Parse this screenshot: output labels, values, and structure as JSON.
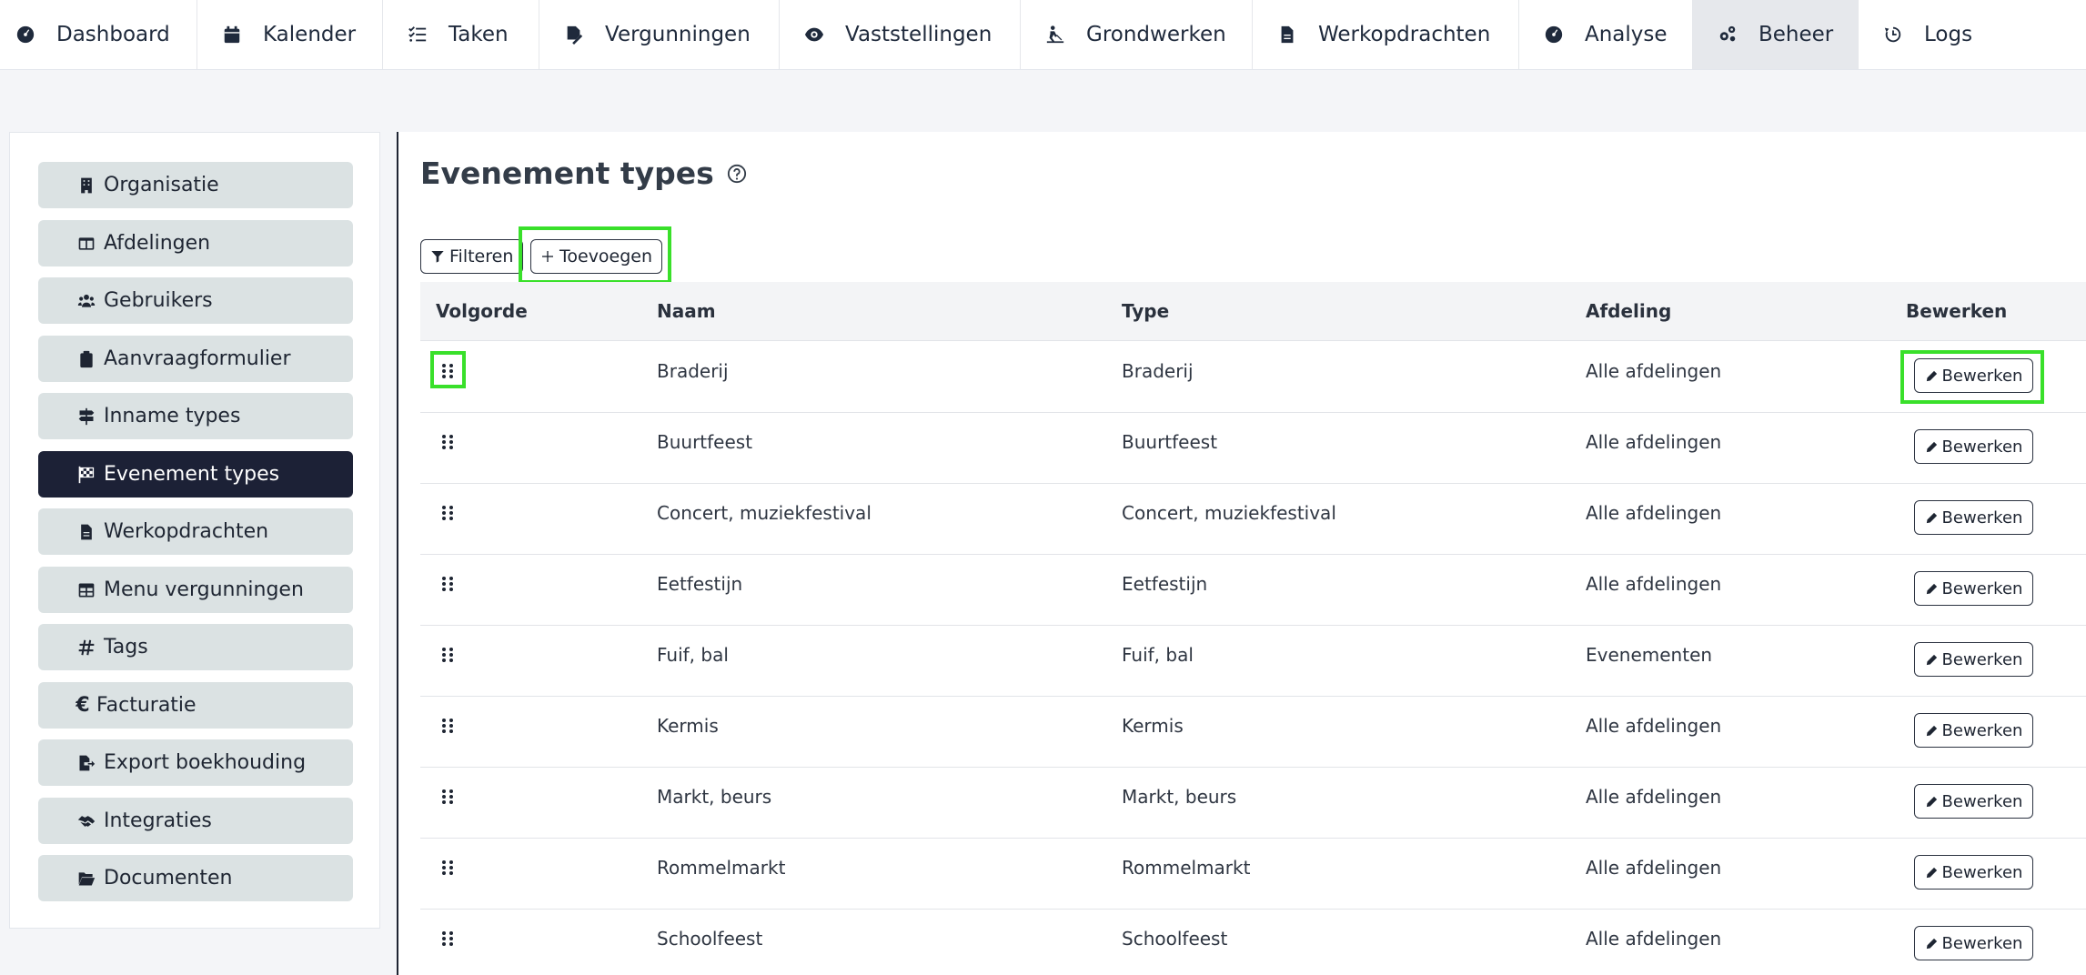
{
  "topnav": {
    "items": [
      {
        "label": "Dashboard",
        "icon": "gauge-icon"
      },
      {
        "label": "Kalender",
        "icon": "calendar-icon"
      },
      {
        "label": "Taken",
        "icon": "checklist-icon"
      },
      {
        "label": "Vergunningen",
        "icon": "signed-file-icon"
      },
      {
        "label": "Vaststellingen",
        "icon": "eye-icon"
      },
      {
        "label": "Grondwerken",
        "icon": "digging-icon"
      },
      {
        "label": "Werkopdrachten",
        "icon": "document-icon"
      },
      {
        "label": "Analyse",
        "icon": "gauge-icon"
      },
      {
        "label": "Beheer",
        "icon": "gears-icon",
        "active": true
      },
      {
        "label": "Logs",
        "icon": "history-icon"
      }
    ]
  },
  "sidebar": {
    "items": [
      {
        "label": "Organisatie",
        "icon": "building-icon"
      },
      {
        "label": "Afdelingen",
        "icon": "columns-icon"
      },
      {
        "label": "Gebruikers",
        "icon": "users-icon"
      },
      {
        "label": "Aanvraagformulier",
        "icon": "clipboard-icon"
      },
      {
        "label": "Inname types",
        "icon": "signs-icon"
      },
      {
        "label": "Evenement types",
        "icon": "flag-checkered-icon",
        "active": true
      },
      {
        "label": "Werkopdrachten",
        "icon": "document-icon"
      },
      {
        "label": "Menu vergunningen",
        "icon": "table-icon"
      },
      {
        "label": "Tags",
        "icon": "hashtag-icon"
      },
      {
        "label": "Facturatie",
        "icon": "euro-icon"
      },
      {
        "label": "Export boekhouding",
        "icon": "file-export-icon"
      },
      {
        "label": "Integraties",
        "icon": "handshake-icon"
      },
      {
        "label": "Documenten",
        "icon": "folder-open-icon"
      }
    ]
  },
  "page": {
    "title": "Evenement types",
    "filter_label": "Filteren",
    "add_label": "Toevoegen"
  },
  "table": {
    "headers": {
      "order": "Volgorde",
      "name": "Naam",
      "type": "Type",
      "department": "Afdeling",
      "edit": "Bewerken"
    },
    "edit_label": "Bewerken",
    "rows": [
      {
        "name": "Braderij",
        "type": "Braderij",
        "department": "Alle afdelingen"
      },
      {
        "name": "Buurtfeest",
        "type": "Buurtfeest",
        "department": "Alle afdelingen"
      },
      {
        "name": "Concert, muziekfestival",
        "type": "Concert, muziekfestival",
        "department": "Alle afdelingen"
      },
      {
        "name": "Eetfestijn",
        "type": "Eetfestijn",
        "department": "Alle afdelingen"
      },
      {
        "name": "Fuif, bal",
        "type": "Fuif, bal",
        "department": "Evenementen"
      },
      {
        "name": "Kermis",
        "type": "Kermis",
        "department": "Alle afdelingen"
      },
      {
        "name": "Markt, beurs",
        "type": "Markt, beurs",
        "department": "Alle afdelingen"
      },
      {
        "name": "Rommelmarkt",
        "type": "Rommelmarkt",
        "department": "Alle afdelingen"
      },
      {
        "name": "Schoolfeest",
        "type": "Schoolfeest",
        "department": "Alle afdelingen"
      }
    ]
  },
  "colors": {
    "highlight": "#39e02a",
    "active_sidebar": "#1c2136",
    "sidebar_item": "#dbe2e3"
  }
}
